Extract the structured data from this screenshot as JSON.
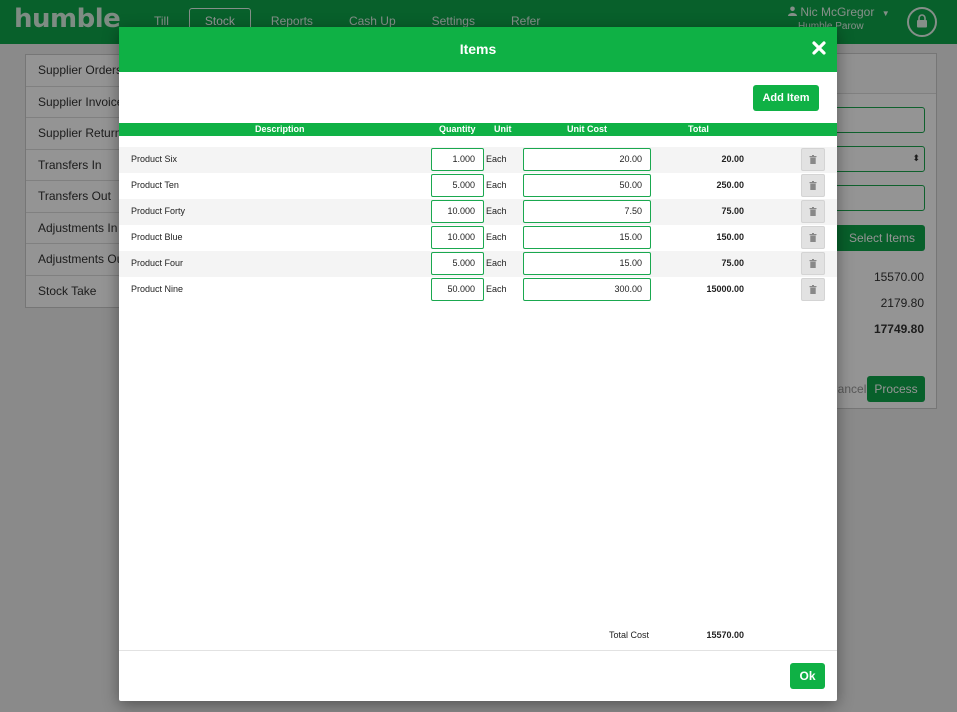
{
  "app": {
    "logo": "humble"
  },
  "nav": {
    "items": [
      {
        "label": "Till"
      },
      {
        "label": "Stock"
      },
      {
        "label": "Reports"
      },
      {
        "label": "Cash Up"
      },
      {
        "label": "Settings"
      },
      {
        "label": "Refer"
      }
    ],
    "active": "Stock"
  },
  "user": {
    "name": "Nic McGregor",
    "store": "Humble Parow"
  },
  "sidebar": {
    "items": [
      {
        "label": "Supplier Orders"
      },
      {
        "label": "Supplier Invoices"
      },
      {
        "label": "Supplier Returns"
      },
      {
        "label": "Transfers In"
      },
      {
        "label": "Transfers Out"
      },
      {
        "label": "Adjustments In"
      },
      {
        "label": "Adjustments Out"
      },
      {
        "label": "Stock Take"
      }
    ]
  },
  "right_panel": {
    "select_items_label": "Select Items",
    "subtotal": "15570.00",
    "tax": "2179.80",
    "total": "17749.80",
    "cancel_label": "Cancel",
    "process_label": "Process"
  },
  "modal": {
    "title": "Items",
    "add_item_label": "Add Item",
    "headers": {
      "description": "Description",
      "quantity": "Quantity",
      "unit": "Unit",
      "unit_cost": "Unit Cost",
      "total": "Total"
    },
    "rows": [
      {
        "description": "Product Six",
        "quantity": "1.000",
        "unit": "Each",
        "unit_cost": "20.00",
        "total": "20.00"
      },
      {
        "description": "Product Ten",
        "quantity": "5.000",
        "unit": "Each",
        "unit_cost": "50.00",
        "total": "250.00"
      },
      {
        "description": "Product Forty",
        "quantity": "10.000",
        "unit": "Each",
        "unit_cost": "7.50",
        "total": "75.00"
      },
      {
        "description": "Product Blue",
        "quantity": "10.000",
        "unit": "Each",
        "unit_cost": "15.00",
        "total": "150.00"
      },
      {
        "description": "Product Four",
        "quantity": "5.000",
        "unit": "Each",
        "unit_cost": "15.00",
        "total": "75.00"
      },
      {
        "description": "Product Nine",
        "quantity": "50.000",
        "unit": "Each",
        "unit_cost": "300.00",
        "total": "15000.00"
      }
    ],
    "total_cost_label": "Total Cost",
    "total_cost": "15570.00",
    "ok_label": "Ok"
  },
  "colors": {
    "brand_green": "#0fb145",
    "nav_green": "#0ea54a"
  },
  "icons": {
    "close": "close-icon",
    "delete": "trash-icon",
    "lock": "lock-icon",
    "user": "user-icon"
  }
}
